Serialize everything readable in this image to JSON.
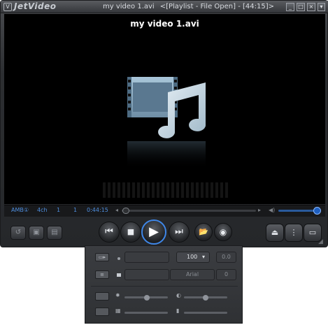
{
  "app": {
    "logo_mark": "V",
    "brand": "JetVideo",
    "title_file": "my video 1.avi",
    "title_mode": "<[Playlist - File Open] - [44:15]>"
  },
  "window_controls": {
    "minimize": "_",
    "maximize": "□",
    "close": "×"
  },
  "video": {
    "overlay_title": "my video 1.avi"
  },
  "status": {
    "audio_label": "AMB",
    "audio_icon": "①",
    "channel_label": "4ch",
    "track": "1",
    "chapter": "1",
    "elapsed": "0:44:15",
    "seek_fraction": 0.03,
    "volume_fraction": 0.95
  },
  "controls": {
    "prev": "⏮",
    "stop": "■",
    "play": "▶",
    "next": "⏭",
    "open_folder": "📂",
    "open_disc": "◉",
    "eject": "⏏",
    "mid_tool": "⋮",
    "fullscreen": "▭",
    "left_tools": [
      "↺",
      "▣",
      "▤"
    ]
  },
  "panel": {
    "zoom_value": "100",
    "zoom_arrow": "▾",
    "offset_value": "0.0",
    "font_value": "Arial",
    "size_value": "0"
  },
  "colors": {
    "accent": "#3f87e8",
    "status_text": "#4f8fe0"
  }
}
